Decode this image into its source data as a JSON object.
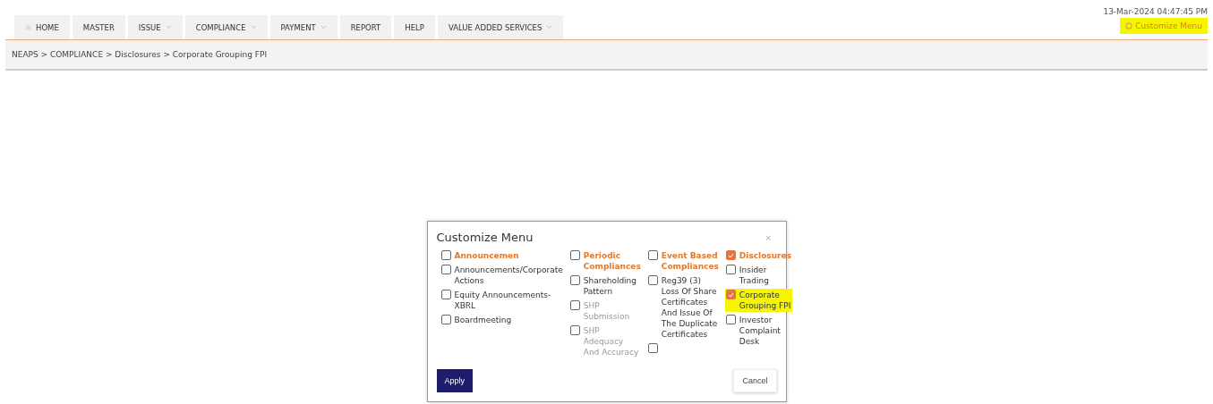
{
  "nav": {
    "tabs": [
      {
        "label": "HOME",
        "has_icon": true,
        "dropdown": false
      },
      {
        "label": "MASTER",
        "has_icon": false,
        "dropdown": false
      },
      {
        "label": "ISSUE",
        "has_icon": false,
        "dropdown": true
      },
      {
        "label": "COMPLIANCE",
        "has_icon": false,
        "dropdown": true
      },
      {
        "label": "PAYMENT",
        "has_icon": false,
        "dropdown": true
      },
      {
        "label": "REPORT",
        "has_icon": false,
        "dropdown": false
      },
      {
        "label": "HELP",
        "has_icon": false,
        "dropdown": false
      },
      {
        "label": "VALUE ADDED SERVICES",
        "has_icon": false,
        "dropdown": true
      }
    ],
    "datetime": "13-Mar-2024 04:47:45 PM",
    "customize_link": {
      "label": "Customize Menu",
      "highlighted": true
    }
  },
  "breadcrumb": "NEAPS > COMPLIANCE > Disclosures > Corporate Grouping FPI",
  "modal": {
    "title": "Customize Menu",
    "close": "×",
    "columns": [
      {
        "heading": {
          "label": "Announcemen",
          "checked": false
        },
        "items": [
          {
            "label": "Announcements/Corporate Actions",
            "checked": false,
            "disabled": false,
            "highlighted": false
          },
          {
            "label": "Equity Announcements-XBRL",
            "checked": false,
            "disabled": false,
            "highlighted": false
          },
          {
            "label": "Boardmeeting",
            "checked": false,
            "disabled": false,
            "highlighted": false
          }
        ]
      },
      {
        "heading": {
          "label": "Periodic Compliances",
          "checked": false
        },
        "items": [
          {
            "label": "Shareholding Pattern",
            "checked": false,
            "disabled": false,
            "highlighted": false
          },
          {
            "label": "SHP Submission",
            "checked": false,
            "disabled": true,
            "highlighted": false
          },
          {
            "label": "SHP Adequacy And Accuracy",
            "checked": false,
            "disabled": true,
            "highlighted": false
          }
        ]
      },
      {
        "heading": {
          "label": "Event Based Compliances",
          "checked": false
        },
        "items": [
          {
            "label": "Reg39 (3) Loss Of Share Certificates And Issue Of The Duplicate Certificates",
            "checked": false,
            "disabled": false,
            "highlighted": false
          },
          {
            "checked": false
          }
        ]
      },
      {
        "heading": {
          "label": "Disclosures",
          "checked": true
        },
        "items": [
          {
            "label": "Insider Trading",
            "checked": false,
            "disabled": false,
            "highlighted": false
          },
          {
            "label": "Corporate Grouping FPI",
            "checked": true,
            "disabled": false,
            "highlighted": true
          },
          {
            "label": "Investor Complaint Desk",
            "checked": false,
            "disabled": false,
            "highlighted": false
          }
        ]
      }
    ],
    "buttons": [
      {
        "label": "Apply",
        "kind": "primary"
      },
      {
        "label": "Cancel",
        "kind": "secondary"
      }
    ]
  }
}
